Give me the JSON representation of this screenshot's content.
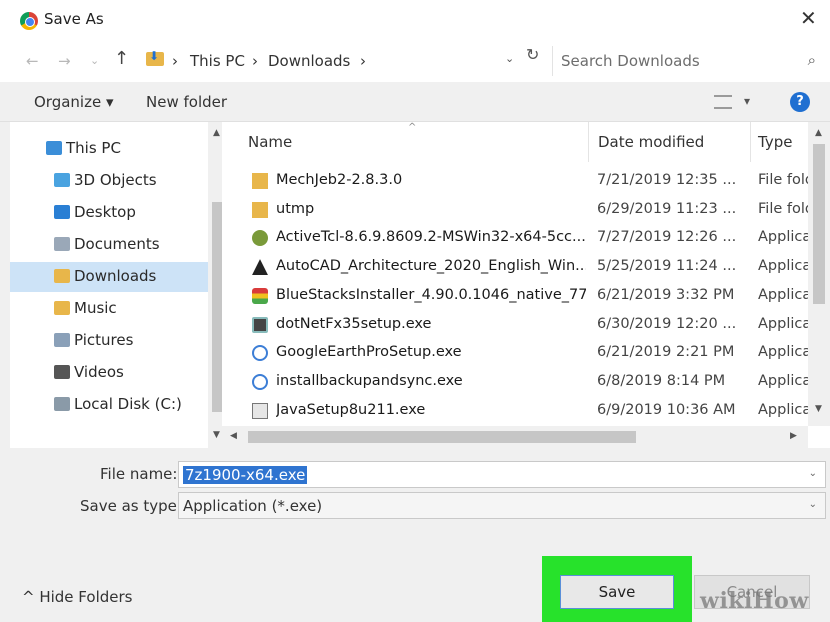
{
  "window": {
    "title": "Save As",
    "close": "✕"
  },
  "address": {
    "back": "←",
    "forward": "→",
    "recent": "⌄",
    "up": "↑",
    "sep": "›",
    "crumbs": [
      "This PC",
      "Downloads"
    ],
    "dropdown": "⌄",
    "refresh": "↻",
    "search_placeholder": "Search Downloads",
    "search_icon": "⌕"
  },
  "toolbar": {
    "organize": "Organize ▾",
    "new_folder": "New folder",
    "view_dd": "▾",
    "help": "?"
  },
  "nav": {
    "items": [
      {
        "label": "This PC",
        "icon": "pc-icon",
        "color": "#3b8ed8"
      },
      {
        "label": "3D Objects",
        "icon": "3d-objects-icon",
        "color": "#4aa3e0"
      },
      {
        "label": "Desktop",
        "icon": "desktop-folder-icon",
        "color": "#2a7fd4"
      },
      {
        "label": "Documents",
        "icon": "documents-icon",
        "color": "#9aa8b8"
      },
      {
        "label": "Downloads",
        "icon": "downloads-icon",
        "color": "#e8b64a",
        "selected": true
      },
      {
        "label": "Music",
        "icon": "music-icon",
        "color": "#e8b64a"
      },
      {
        "label": "Pictures",
        "icon": "pictures-icon",
        "color": "#8aa0b8"
      },
      {
        "label": "Videos",
        "icon": "videos-icon",
        "color": "#555555"
      },
      {
        "label": "Local Disk (C:)",
        "icon": "local-disk-icon",
        "color": "#8a9aa8"
      }
    ]
  },
  "files": {
    "columns": {
      "name": "Name",
      "date": "Date modified",
      "type": "Type"
    },
    "sort_arrow": "^",
    "rows": [
      {
        "name": "MechJeb2-2.8.3.0",
        "date": "7/21/2019 12:35 ...",
        "type": "File folder",
        "icon": "folder-icon",
        "cls": "ic-folder"
      },
      {
        "name": "utmp",
        "date": "6/29/2019 11:23 ...",
        "type": "File folder",
        "icon": "folder-icon",
        "cls": "ic-folder"
      },
      {
        "name": "ActiveTcl-8.6.9.8609.2-MSWin32-x64-5cc...",
        "date": "7/27/2019 12:26 ...",
        "type": "Application",
        "icon": "activetcl-icon",
        "cls": "ic-tcl"
      },
      {
        "name": "AutoCAD_Architecture_2020_English_Win...",
        "date": "5/25/2019 11:24 ...",
        "type": "Application",
        "icon": "autocad-icon",
        "cls": "ic-acad"
      },
      {
        "name": "BlueStacksInstaller_4.90.0.1046_native_77...",
        "date": "6/21/2019 3:32 PM",
        "type": "Application",
        "icon": "bluestacks-icon",
        "cls": "ic-bs"
      },
      {
        "name": "dotNetFx35setup.exe",
        "date": "6/30/2019 12:20 ...",
        "type": "Application",
        "icon": "dotnet-installer-icon",
        "cls": "ic-net"
      },
      {
        "name": "GoogleEarthProSetup.exe",
        "date": "6/21/2019 2:21 PM",
        "type": "Application",
        "icon": "setup-icon",
        "cls": "ic-setup"
      },
      {
        "name": "installbackupandsync.exe",
        "date": "6/8/2019 8:14 PM",
        "type": "Application",
        "icon": "setup-icon",
        "cls": "ic-setup"
      },
      {
        "name": "JavaSetup8u211.exe",
        "date": "6/9/2019 10:36 AM",
        "type": "Application",
        "icon": "java-setup-icon",
        "cls": "ic-java"
      }
    ]
  },
  "form": {
    "file_name_label": "File name:",
    "file_name_value": "7z1900-x64.exe",
    "save_type_label": "Save as type:",
    "save_type_value": "Application (*.exe)",
    "dd_arrow": "⌄"
  },
  "footer": {
    "hide_folders": "^ Hide Folders",
    "save": "Save",
    "cancel": "Cancel",
    "watermark": "wikiHow",
    "highlight_color": "#27e22b"
  }
}
